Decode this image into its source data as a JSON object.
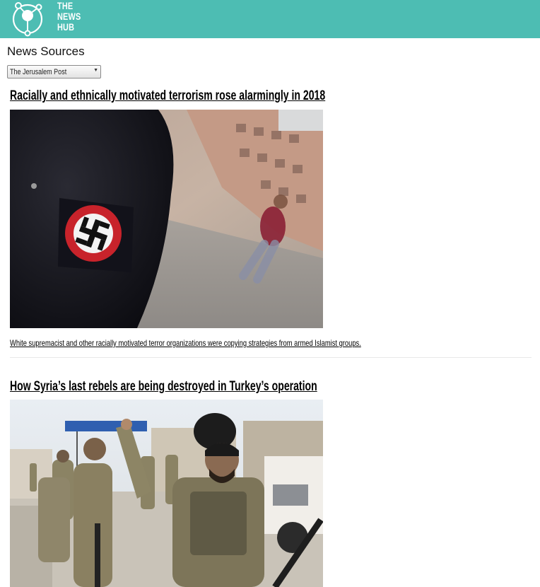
{
  "brand": {
    "name_lines": [
      "THE",
      "NEWS",
      "HUB"
    ],
    "bar_color": "#4dbdb3",
    "logo_icon": "network-hub-icon"
  },
  "sources": {
    "title": "News Sources",
    "selected": "The Jerusalem Post"
  },
  "articles": [
    {
      "headline": "Racially and ethnically motivated terrorism rose alarmingly in 2018",
      "image_description": "swastika-armband-photo",
      "caption": "White supremacist and other racially motivated terror organizations were copying strategies from armed Islamist groups."
    },
    {
      "headline": "How Syria’s last rebels are being destroyed in Turkey’s operation",
      "image_description": "rebel-fighters-photo",
      "caption": ""
    }
  ]
}
